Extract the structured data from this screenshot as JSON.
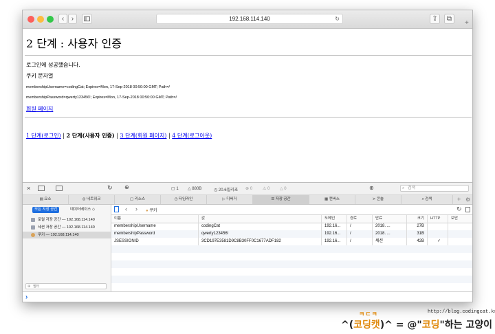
{
  "browser": {
    "address": "192.168.114.140"
  },
  "page": {
    "title": "2 단계 : 사용자 인증",
    "login_success": "로그인에 성공했습니다.",
    "cookie_heading": "쿠키 문자열",
    "cookie_line1": "membershipUsername=codingCat; Expires=Mon, 17-Sep-2018 00:50:00 GMT; Path=/",
    "cookie_line2": "membershipPassword=qwerty123456!; Expires=Mon, 17-Sep-2018 00:50:00 GMT; Path=/",
    "member_page_link": "회원 페이지",
    "nav": {
      "step1": "1 단계(로그인)",
      "sep": " | ",
      "step2": "2 단계(사용자 인증)",
      "step3": "3 단계(회원 페이지)",
      "step4": "4 단계(로그아웃)"
    }
  },
  "inspector": {
    "toolbar": {
      "doc_count": "1",
      "size": "880B",
      "time": "20.6밀리초",
      "errors": "0",
      "warnings": "0",
      "logs": "0",
      "search_placeholder": "검색"
    },
    "tabs": [
      "요소",
      "네트워크",
      "리소스",
      "타임라인",
      "디버거",
      "저장 공간",
      "캔버스",
      "콘솔",
      "검색"
    ],
    "active_tab": "저장 공간",
    "storage_filter": {
      "all": "모든 저장 공간",
      "database": "데이터베이스 ◇"
    },
    "sidebar_items": [
      "로컬 저장 공간 — 192.168.114.140",
      "세션 저장 공간 — 192.168.114.140",
      "쿠키 — 192.168.114.140"
    ],
    "filter_placeholder": "필터",
    "breadcrumb": "쿠키",
    "columns": [
      "이름",
      "값",
      "도메인",
      "경로",
      "만료",
      "크기",
      "HTTP",
      "보안"
    ],
    "cookies": [
      {
        "name": "membershipUsername",
        "value": "codingCat",
        "domain": "192.16...",
        "path": "/",
        "expires": "2018. ...",
        "size": "27B",
        "http": "",
        "secure": ""
      },
      {
        "name": "membershipPassword",
        "value": "qwerty123456!",
        "domain": "192.16...",
        "path": "/",
        "expires": "2018. ...",
        "size": "31B",
        "http": "",
        "secure": ""
      },
      {
        "name": "JSESSIONID",
        "value": "3CD197E3581D9C8B30FF0C1677ADF182",
        "domain": "192.16...",
        "path": "/",
        "expires": "세션",
        "size": "42B",
        "http": "✓",
        "secure": ""
      }
    ],
    "console_prompt": "›"
  },
  "watermark": {
    "url": "http://blog.codingcat.kr/",
    "small": "ㅋㄷㅋ",
    "main_prefix": "^(",
    "main_kw1": "코딩캣",
    "main_mid": ")^ = @\"",
    "main_kw2": "코딩",
    "main_suffix": "\"하는 고양이"
  },
  "colors": {
    "accent": "#1f6fe0",
    "link": "#0000ee",
    "watermark_orange": "#e08a0d"
  }
}
